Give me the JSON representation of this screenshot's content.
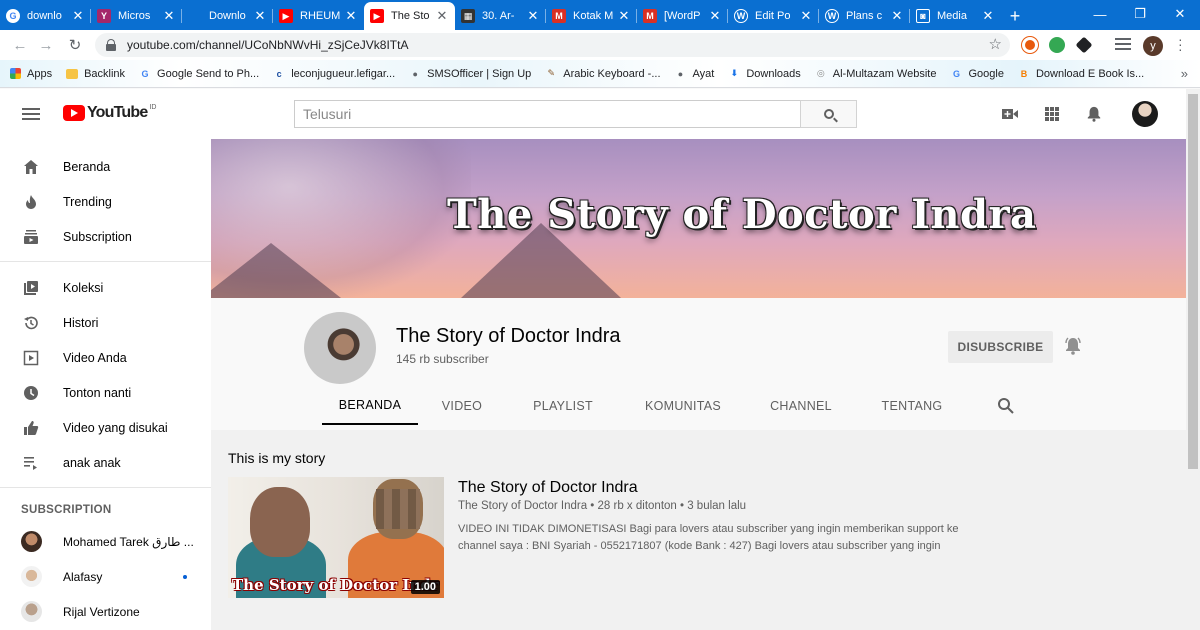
{
  "browser": {
    "tabs": [
      {
        "title": "downlo",
        "icon": "google-icon",
        "color": "#4285f4",
        "glyph": "G",
        "active": false
      },
      {
        "title": "Micros",
        "icon": "yoast-icon",
        "color": "#a4286a",
        "glyph": "Y",
        "active": false
      },
      {
        "title": "Downlo",
        "icon": "blank-tab-icon",
        "color": "#0a6fd1",
        "glyph": "",
        "active": false
      },
      {
        "title": "RHEUM",
        "icon": "youtube-icon",
        "color": "#ff0000",
        "glyph": "▶",
        "active": false
      },
      {
        "title": "The Sto",
        "icon": "youtube-icon",
        "color": "#ff0000",
        "glyph": "▶",
        "active": true
      },
      {
        "title": "30. Ar-",
        "icon": "page-icon",
        "color": "#333333",
        "glyph": "▦",
        "active": false
      },
      {
        "title": "Kotak M",
        "icon": "gmail-icon",
        "color": "#d93025",
        "glyph": "M",
        "active": false
      },
      {
        "title": "[WordP",
        "icon": "gmail-icon",
        "color": "#d93025",
        "glyph": "M",
        "active": false
      },
      {
        "title": "Edit Po",
        "icon": "wordpress-icon",
        "color": "#ffffff",
        "glyph": "W",
        "active": false
      },
      {
        "title": "Plans c",
        "icon": "wordpress-icon",
        "color": "#ffffff",
        "glyph": "W",
        "active": false
      },
      {
        "title": "Media",
        "icon": "media-icon",
        "color": "#ffffff",
        "glyph": "◙",
        "active": false
      }
    ],
    "new_tab": "+",
    "url": "youtube.com/channel/UCoNbNWvHi_zSjCeJVk8ITtA",
    "profile_initial": "y",
    "bookmarks": [
      {
        "label": "Apps",
        "icon": "apps-icon",
        "color": "#ea4335",
        "glyph": "⋮"
      },
      {
        "label": "Backlink",
        "icon": "folder-icon",
        "color": "#f6c445",
        "glyph": ""
      },
      {
        "label": "Google Send to Ph...",
        "icon": "google-icon",
        "color": "#4285f4",
        "glyph": "G"
      },
      {
        "label": "leconjugueur.lefigar...",
        "icon": "leconjugueur-icon",
        "color": "#1c4fa1",
        "glyph": "c"
      },
      {
        "label": "SMSOfficer | Sign Up",
        "icon": "globe-icon",
        "color": "#5f6368",
        "glyph": "●"
      },
      {
        "label": "Arabic Keyboard -...",
        "icon": "keyboard-icon",
        "color": "#8a5a2b",
        "glyph": "✎"
      },
      {
        "label": "Ayat",
        "icon": "globe-icon",
        "color": "#5f6368",
        "glyph": "●"
      },
      {
        "label": "Downloads",
        "icon": "download-icon",
        "color": "#1a73e8",
        "glyph": "⬇"
      },
      {
        "label": "Al-Multazam Website",
        "icon": "site-icon",
        "color": "#8a8a8a",
        "glyph": "◎"
      },
      {
        "label": "Google",
        "icon": "google-icon",
        "color": "#4285f4",
        "glyph": "G"
      },
      {
        "label": "Download E Book Is...",
        "icon": "blogger-icon",
        "color": "#f57d00",
        "glyph": "B"
      }
    ]
  },
  "youtube": {
    "logo_text": "YouTube",
    "logo_country": "ID",
    "search_placeholder": "Telusuri",
    "sidebar": {
      "main": [
        {
          "label": "Beranda",
          "icon": "home-icon"
        },
        {
          "label": "Trending",
          "icon": "trending-icon"
        },
        {
          "label": "Subscription",
          "icon": "subscriptions-icon"
        }
      ],
      "library": [
        {
          "label": "Koleksi",
          "icon": "library-icon"
        },
        {
          "label": "Histori",
          "icon": "history-icon"
        },
        {
          "label": "Video Anda",
          "icon": "your-videos-icon"
        },
        {
          "label": "Tonton nanti",
          "icon": "watch-later-icon"
        },
        {
          "label": "Video yang disukai",
          "icon": "liked-icon"
        },
        {
          "label": "anak anak",
          "icon": "playlist-icon"
        }
      ],
      "subscription_heading": "SUBSCRIPTION",
      "subscriptions": [
        {
          "name": "Mohamed Tarek محمد طارق",
          "display": "Mohamed Tarek طارق ...",
          "new": false
        },
        {
          "name": "Alafasy",
          "display": "Alafasy",
          "new": true
        },
        {
          "name": "Rijal Vertizone",
          "display": "Rijal Vertizone",
          "new": false
        }
      ]
    },
    "channel": {
      "banner_text": "The Story of Doctor Indra",
      "name": "The Story of Doctor Indra",
      "subscribers": "145 rb subscriber",
      "subscribe_label": "DISUBSCRIBE",
      "tabs": [
        "BERANDA",
        "VIDEO",
        "PLAYLIST",
        "KOMUNITAS",
        "CHANNEL",
        "TENTANG"
      ],
      "active_tab": "BERANDA"
    },
    "shelf": {
      "title": "This is my story",
      "video": {
        "thumbnail_text": "The Story of Doctor Indr",
        "duration": "1.00",
        "title": "The Story of Doctor Indra",
        "meta": "The Story of Doctor Indra • 28 rb x ditonton • 3 bulan lalu",
        "description": "VIDEO INI TIDAK DIMONETISASI Bagi para lovers atau subscriber yang ingin memberikan support ke channel saya : BNI Syariah - 0552171807 (kode Bank : 427) Bagi lovers atau subscriber yang ingin"
      }
    }
  }
}
